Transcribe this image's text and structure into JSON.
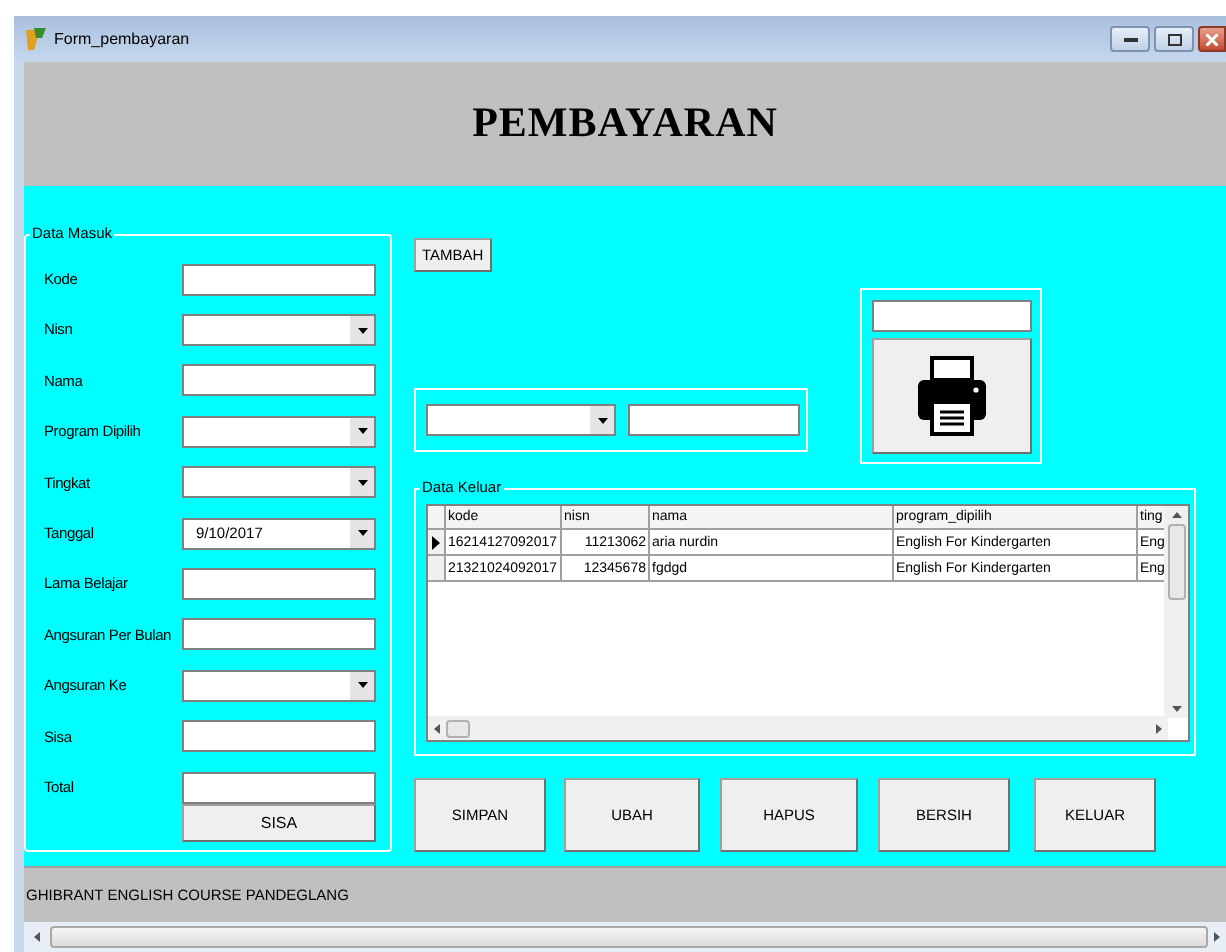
{
  "window": {
    "title": "Form_pembayaran"
  },
  "header": {
    "title": "PEMBAYARAN"
  },
  "data_masuk": {
    "legend": "Data Masuk",
    "fields": [
      {
        "label": "Kode",
        "kind": "text"
      },
      {
        "label": "Nisn",
        "kind": "combo"
      },
      {
        "label": "Nama",
        "kind": "text"
      },
      {
        "label": "Program Dipilih",
        "kind": "combo"
      },
      {
        "label": "Tingkat",
        "kind": "combo"
      },
      {
        "label": "Tanggal",
        "kind": "combo",
        "value": "9/10/2017"
      },
      {
        "label": "Lama Belajar",
        "kind": "text"
      },
      {
        "label": "Angsuran Per Bulan",
        "kind": "text"
      },
      {
        "label": "Angsuran Ke",
        "kind": "combo"
      },
      {
        "label": "Sisa",
        "kind": "text"
      },
      {
        "label": "Total",
        "kind": "text"
      }
    ],
    "button": "SISA"
  },
  "tambah_button": "TAMBAH",
  "data_keluar": {
    "legend": "Data Keluar",
    "columns": [
      "kode",
      "nisn",
      "nama",
      "program_dipilih",
      "ting"
    ],
    "rows": [
      {
        "selected": true,
        "cells": [
          "16214127092017",
          "11213062",
          "aria nurdin",
          "English For Kindergarten",
          "Eng"
        ]
      },
      {
        "selected": false,
        "cells": [
          "21321024092017",
          "12345678",
          "fgdgd",
          "English For Kindergarten",
          "Eng"
        ]
      }
    ]
  },
  "buttons": [
    "SIMPAN",
    "UBAH",
    "HAPUS",
    "BERSIH",
    "KELUAR"
  ],
  "status_bar": "GHIBRANT ENGLISH COURSE PANDEGLANG"
}
